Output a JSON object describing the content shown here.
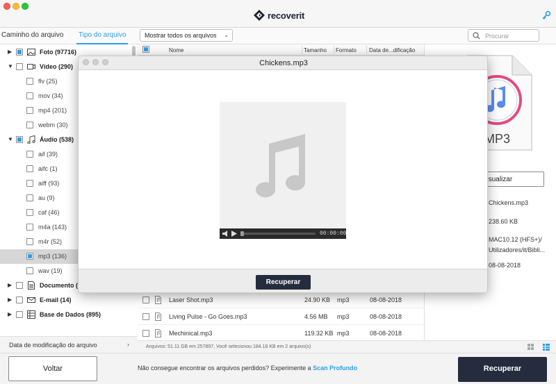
{
  "app": {
    "brand": "recoverit"
  },
  "left_tabs": {
    "path_tab": "Caminho do arquivo",
    "type_tab": "Tipo do arquivo"
  },
  "tree": [
    {
      "label": "Foto (97716)",
      "bold": true,
      "arrow": "▶",
      "state": "partial",
      "icon": "photo-icon",
      "level": 0
    },
    {
      "label": "Vídeo (290)",
      "bold": true,
      "arrow": "▼",
      "state": "empty",
      "icon": "video-icon",
      "level": 0
    },
    {
      "label": "flv (25)",
      "state": "empty",
      "level": 1
    },
    {
      "label": "mov (34)",
      "state": "empty",
      "level": 1
    },
    {
      "label": "mp4 (201)",
      "state": "empty",
      "level": 1
    },
    {
      "label": "webm (30)",
      "state": "empty",
      "level": 1
    },
    {
      "label": "Áudio (538)",
      "bold": true,
      "arrow": "▼",
      "state": "partial",
      "icon": "music-note-icon",
      "level": 0
    },
    {
      "label": "aif (39)",
      "state": "empty",
      "level": 1
    },
    {
      "label": "aifc (1)",
      "state": "empty",
      "level": 1
    },
    {
      "label": "aiff (93)",
      "state": "empty",
      "level": 1
    },
    {
      "label": "au (9)",
      "state": "empty",
      "level": 1
    },
    {
      "label": "caf (46)",
      "state": "empty",
      "level": 1
    },
    {
      "label": "m4a (143)",
      "state": "empty",
      "level": 1
    },
    {
      "label": "m4r (52)",
      "state": "empty",
      "level": 1
    },
    {
      "label": "mp3 (136)",
      "state": "partial",
      "level": 1,
      "selected": true
    },
    {
      "label": "wav (19)",
      "state": "empty",
      "level": 1
    },
    {
      "label": "Documento (",
      "bold": true,
      "arrow": "▶",
      "state": "empty",
      "icon": "document-icon",
      "level": 0
    },
    {
      "label": "E-mail (14)",
      "bold": true,
      "arrow": "▶",
      "state": "empty",
      "icon": "email-icon",
      "level": 0
    },
    {
      "label": "Base de Dados (895)",
      "bold": true,
      "arrow": "▶",
      "state": "empty",
      "icon": "database-icon",
      "level": 0
    }
  ],
  "sort": {
    "label": "Data de modificação do arquivo"
  },
  "toolbar": {
    "filter_value": "Mostrar todos os arquivos",
    "search_placeholder": "Procurar"
  },
  "columns": {
    "name": "Nome",
    "size": "Tamanho",
    "format": "Formato",
    "date": "Data de...dificação"
  },
  "files": [
    {
      "name": "Laser Shot.mp3",
      "size": "24.90 KB",
      "format": "mp3",
      "date": "08-08-2018"
    },
    {
      "name": "Living Pulse - Go Goes.mp3",
      "size": "4.56 MB",
      "format": "mp3",
      "date": "08-08-2018"
    },
    {
      "name": "Mechinical.mp3",
      "size": "119.32 KB",
      "format": "mp3",
      "date": "08-08-2018"
    }
  ],
  "status": "Arquivos: 51.11 GB em 257897, Você selecionou 184.18 KB em 2 arquivo(s)",
  "preview": {
    "doc_label": "MP3",
    "button": "Visualizar",
    "name": "Chickens.mp3",
    "size": "238.60 KB",
    "path1": "MAC10.12 (HFS+)/",
    "path2": "Utilizadores/it/Bibli...",
    "date": "08-08-2018"
  },
  "modal": {
    "title": "Chickens.mp3",
    "time": "00:00:00",
    "recover": "Recuperar"
  },
  "footer": {
    "back": "Voltar",
    "message": "Não consegue encontrar os arquivos perdidos? Experimente a ",
    "link": "Scan Profundo",
    "recover": "Recuperar"
  },
  "colors": {
    "accent": "#2b9fe8",
    "dark_button": "#242c3e"
  }
}
